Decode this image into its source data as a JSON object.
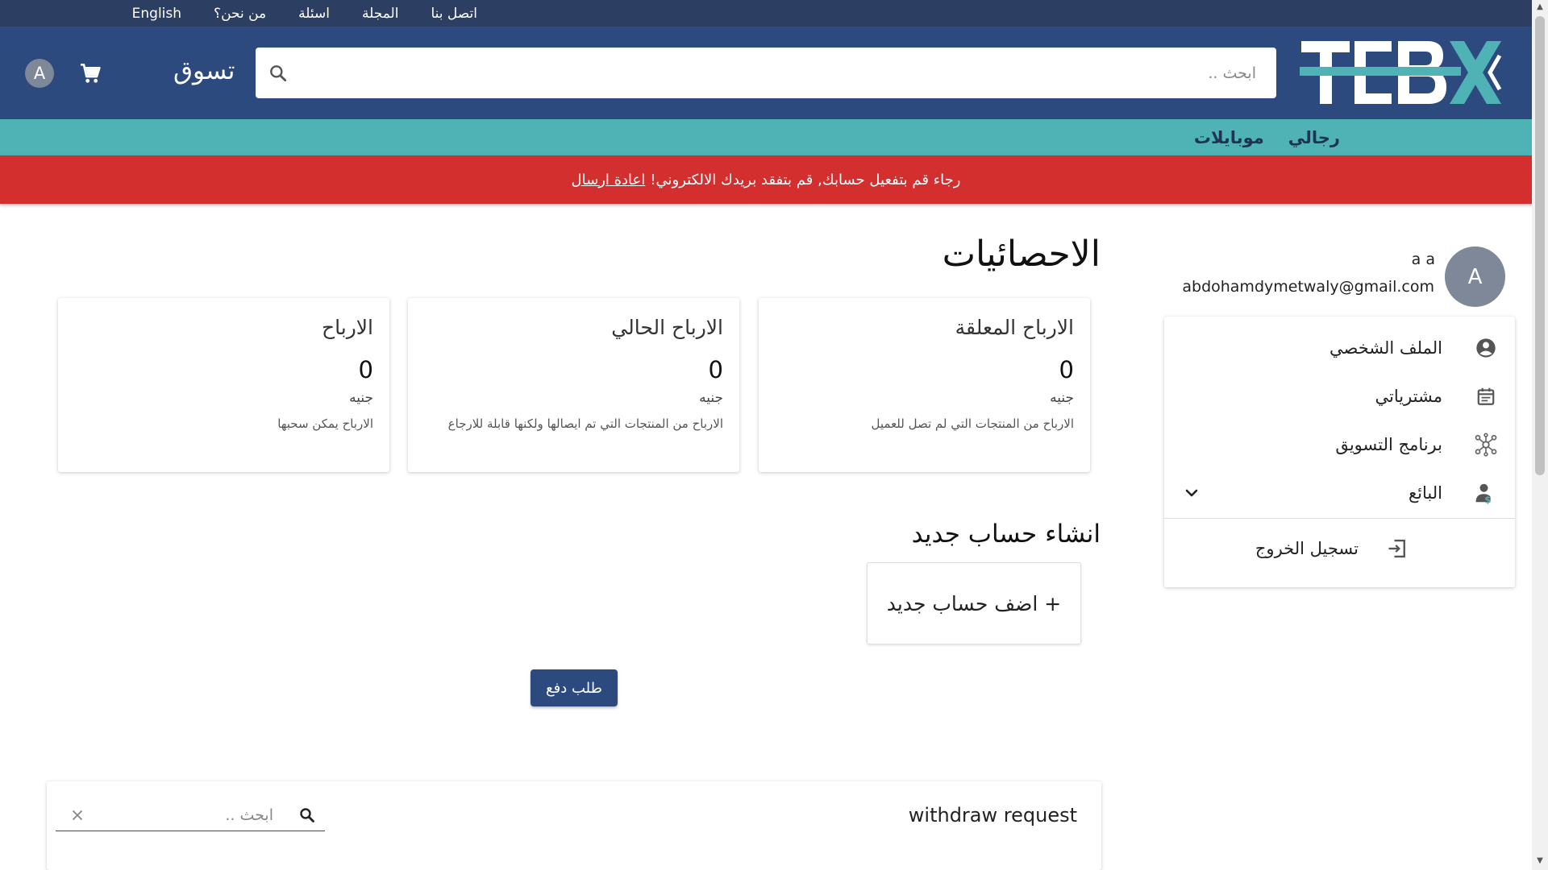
{
  "topbar": {
    "links": [
      "English",
      "من نحن؟",
      "اسئلة",
      "المجلة",
      "اتصل بنا"
    ]
  },
  "header": {
    "logo_text": "TEBX",
    "search_placeholder": "ابحث ..",
    "shop_label": "تسوق",
    "avatar_initial": "A",
    "brand_color": "#2d4a7f",
    "accent_color": "#4fb3b5"
  },
  "categories": [
    "رجالي",
    "موبايلات"
  ],
  "alert": {
    "message": "رجاء قم بتفعيل حسابك, قم بتفقد بريدك الالكتروني!",
    "link": "اعادة ارسال",
    "color": "#d32f2f"
  },
  "user": {
    "initial": "A",
    "name": "a a",
    "email": "abdohamdymetwaly@gmail.com"
  },
  "menu": {
    "items": [
      {
        "label": "الملف الشخصي",
        "icon": "account-circle-icon"
      },
      {
        "label": "مشترياتي",
        "icon": "calendar-icon"
      },
      {
        "label": "برنامج التسويق",
        "icon": "network-icon"
      },
      {
        "label": "البائع",
        "icon": "seller-icon"
      }
    ],
    "logout": "تسجيل الخروج"
  },
  "main": {
    "title": "الاحصائيات",
    "cards": [
      {
        "title": "الارباح المعلقة",
        "value": "0",
        "unit": "جنيه",
        "desc": "الارباح من المنتجات التي لم تصل للعميل"
      },
      {
        "title": "الارباح الحالي",
        "value": "0",
        "unit": "جنيه",
        "desc": "الارباح من المنتجات التي تم ايصالها ولكنها قابلة للارجاع"
      },
      {
        "title": "الارباح",
        "value": "0",
        "unit": "جنيه",
        "desc": "الارباح يمكن سحبها"
      }
    ],
    "new_account_title": "انشاء حساب جديد",
    "add_account_button": "+ اضف حساب جديد",
    "pay_request_button": "طلب دفع",
    "withdraw": {
      "title": "withdraw request",
      "search_placeholder": "ابحث .."
    }
  }
}
